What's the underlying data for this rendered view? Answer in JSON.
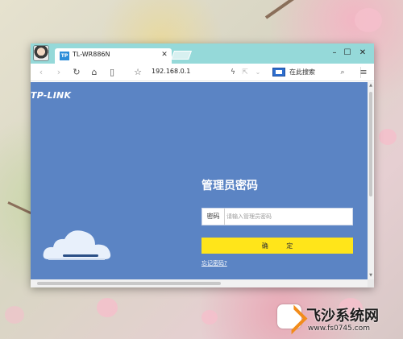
{
  "browser": {
    "tab": {
      "favicon_text": "TP",
      "title": "TL-WR886N"
    },
    "toolbar": {
      "url": "192.168.0.1",
      "search_placeholder": "在此搜索"
    }
  },
  "page": {
    "logo": "TP-LINK",
    "login": {
      "title": "管理员密码",
      "password_label": "密码",
      "password_placeholder": "请输入管理员密码",
      "password_value": "",
      "confirm_label": "确 定",
      "forgot_link": "忘记密码?"
    }
  },
  "watermark": {
    "title": "飞沙系统网",
    "url": "www.fs0745.com"
  },
  "colors": {
    "titlebar": "#95d9d9",
    "page_bg": "#5b84c4",
    "confirm_button": "#ffe51a"
  }
}
